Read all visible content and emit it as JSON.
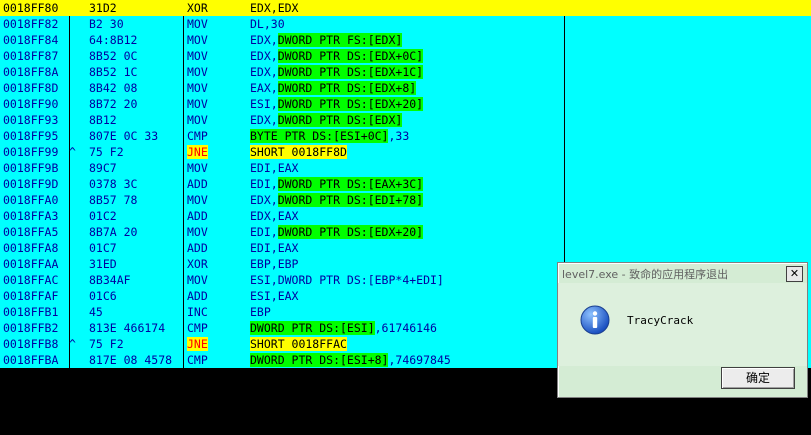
{
  "disasm": {
    "rows": [
      {
        "addr": "0018FF80",
        "mark": "",
        "hex": "31D2",
        "mnemonic": "XOR",
        "operands": [
          {
            "t": "EDX,EDX",
            "h": ""
          }
        ],
        "selected": true,
        "jump": false
      },
      {
        "addr": "0018FF82",
        "mark": "",
        "hex": "B2 30",
        "mnemonic": "MOV",
        "operands": [
          {
            "t": "DL,30",
            "h": ""
          }
        ],
        "selected": false,
        "jump": false
      },
      {
        "addr": "0018FF84",
        "mark": "",
        "hex": "64:8B12",
        "mnemonic": "MOV",
        "operands": [
          {
            "t": "EDX,",
            "h": ""
          },
          {
            "t": "DWORD PTR FS:[EDX]",
            "h": "green"
          }
        ],
        "selected": false,
        "jump": false
      },
      {
        "addr": "0018FF87",
        "mark": "",
        "hex": "8B52 0C",
        "mnemonic": "MOV",
        "operands": [
          {
            "t": "EDX,",
            "h": ""
          },
          {
            "t": "DWORD PTR DS:[EDX+0C]",
            "h": "green"
          }
        ],
        "selected": false,
        "jump": false
      },
      {
        "addr": "0018FF8A",
        "mark": "",
        "hex": "8B52 1C",
        "mnemonic": "MOV",
        "operands": [
          {
            "t": "EDX,",
            "h": ""
          },
          {
            "t": "DWORD PTR DS:[EDX+1C]",
            "h": "green"
          }
        ],
        "selected": false,
        "jump": false
      },
      {
        "addr": "0018FF8D",
        "mark": "",
        "hex": "8B42 08",
        "mnemonic": "MOV",
        "operands": [
          {
            "t": "EAX,",
            "h": ""
          },
          {
            "t": "DWORD PTR DS:[EDX+8]",
            "h": "green"
          }
        ],
        "selected": false,
        "jump": false
      },
      {
        "addr": "0018FF90",
        "mark": "",
        "hex": "8B72 20",
        "mnemonic": "MOV",
        "operands": [
          {
            "t": "ESI,",
            "h": ""
          },
          {
            "t": "DWORD PTR DS:[EDX+20]",
            "h": "green"
          }
        ],
        "selected": false,
        "jump": false
      },
      {
        "addr": "0018FF93",
        "mark": "",
        "hex": "8B12",
        "mnemonic": "MOV",
        "operands": [
          {
            "t": "EDX,",
            "h": ""
          },
          {
            "t": "DWORD PTR DS:[EDX]",
            "h": "green"
          }
        ],
        "selected": false,
        "jump": false
      },
      {
        "addr": "0018FF95",
        "mark": "",
        "hex": "807E 0C 33",
        "mnemonic": "CMP",
        "operands": [
          {
            "t": "BYTE PTR DS:[ESI+0C]",
            "h": "green"
          },
          {
            "t": ",33",
            "h": ""
          }
        ],
        "selected": false,
        "jump": false
      },
      {
        "addr": "0018FF99",
        "mark": "^",
        "hex": "75 F2",
        "mnemonic": "JNE",
        "operands": [
          {
            "t": "SHORT 0018FF8D",
            "h": "yellow"
          }
        ],
        "selected": false,
        "jump": true
      },
      {
        "addr": "0018FF9B",
        "mark": "",
        "hex": "89C7",
        "mnemonic": "MOV",
        "operands": [
          {
            "t": "EDI,EAX",
            "h": ""
          }
        ],
        "selected": false,
        "jump": false
      },
      {
        "addr": "0018FF9D",
        "mark": "",
        "hex": "0378 3C",
        "mnemonic": "ADD",
        "operands": [
          {
            "t": "EDI,",
            "h": ""
          },
          {
            "t": "DWORD PTR DS:[EAX+3C]",
            "h": "green"
          }
        ],
        "selected": false,
        "jump": false
      },
      {
        "addr": "0018FFA0",
        "mark": "",
        "hex": "8B57 78",
        "mnemonic": "MOV",
        "operands": [
          {
            "t": "EDX,",
            "h": ""
          },
          {
            "t": "DWORD PTR DS:[EDI+78]",
            "h": "green"
          }
        ],
        "selected": false,
        "jump": false
      },
      {
        "addr": "0018FFA3",
        "mark": "",
        "hex": "01C2",
        "mnemonic": "ADD",
        "operands": [
          {
            "t": "EDX,EAX",
            "h": ""
          }
        ],
        "selected": false,
        "jump": false
      },
      {
        "addr": "0018FFA5",
        "mark": "",
        "hex": "8B7A 20",
        "mnemonic": "MOV",
        "operands": [
          {
            "t": "EDI,",
            "h": ""
          },
          {
            "t": "DWORD PTR DS:[EDX+20]",
            "h": "green"
          }
        ],
        "selected": false,
        "jump": false
      },
      {
        "addr": "0018FFA8",
        "mark": "",
        "hex": "01C7",
        "mnemonic": "ADD",
        "operands": [
          {
            "t": "EDI,EAX",
            "h": ""
          }
        ],
        "selected": false,
        "jump": false
      },
      {
        "addr": "0018FFAA",
        "mark": "",
        "hex": "31ED",
        "mnemonic": "XOR",
        "operands": [
          {
            "t": "EBP,EBP",
            "h": ""
          }
        ],
        "selected": false,
        "jump": false
      },
      {
        "addr": "0018FFAC",
        "mark": "",
        "hex": "8B34AF",
        "mnemonic": "MOV",
        "operands": [
          {
            "t": "ESI,DWORD PTR DS:[EBP*4+EDI]",
            "h": ""
          }
        ],
        "selected": false,
        "jump": false
      },
      {
        "addr": "0018FFAF",
        "mark": "",
        "hex": "01C6",
        "mnemonic": "ADD",
        "operands": [
          {
            "t": "ESI,EAX",
            "h": ""
          }
        ],
        "selected": false,
        "jump": false
      },
      {
        "addr": "0018FFB1",
        "mark": "",
        "hex": "45",
        "mnemonic": "INC",
        "operands": [
          {
            "t": "EBP",
            "h": ""
          }
        ],
        "selected": false,
        "jump": false
      },
      {
        "addr": "0018FFB2",
        "mark": "",
        "hex": "813E 466174",
        "mnemonic": "CMP",
        "operands": [
          {
            "t": "DWORD PTR DS:[ESI]",
            "h": "green"
          },
          {
            "t": ",61746146",
            "h": ""
          }
        ],
        "selected": false,
        "jump": false
      },
      {
        "addr": "0018FFB8",
        "mark": "^",
        "hex": "75 F2",
        "mnemonic": "JNE",
        "operands": [
          {
            "t": "SHORT 0018FFAC",
            "h": "yellow"
          }
        ],
        "selected": false,
        "jump": true
      },
      {
        "addr": "0018FFBA",
        "mark": "",
        "hex": "817E 08 4578",
        "mnemonic": "CMP",
        "operands": [
          {
            "t": "DWORD PTR DS:[ESI+8]",
            "h": "green"
          },
          {
            "t": ",74697845",
            "h": ""
          }
        ],
        "selected": false,
        "jump": false
      }
    ]
  },
  "dialog": {
    "title": "level7.exe - 致命的应用程序退出",
    "close_glyph": "✕",
    "icon": "info-icon",
    "message": "TracyCrack",
    "ok_label": "确定"
  },
  "colors": {
    "background": "#00ffff",
    "selected_row": "#ffff00",
    "operand_highlight": "#00ff00",
    "jump_highlight": "#ffff00",
    "jump_text": "#ff0000",
    "text": "#0000a0",
    "dialog_bg": "#d4ecd4"
  }
}
